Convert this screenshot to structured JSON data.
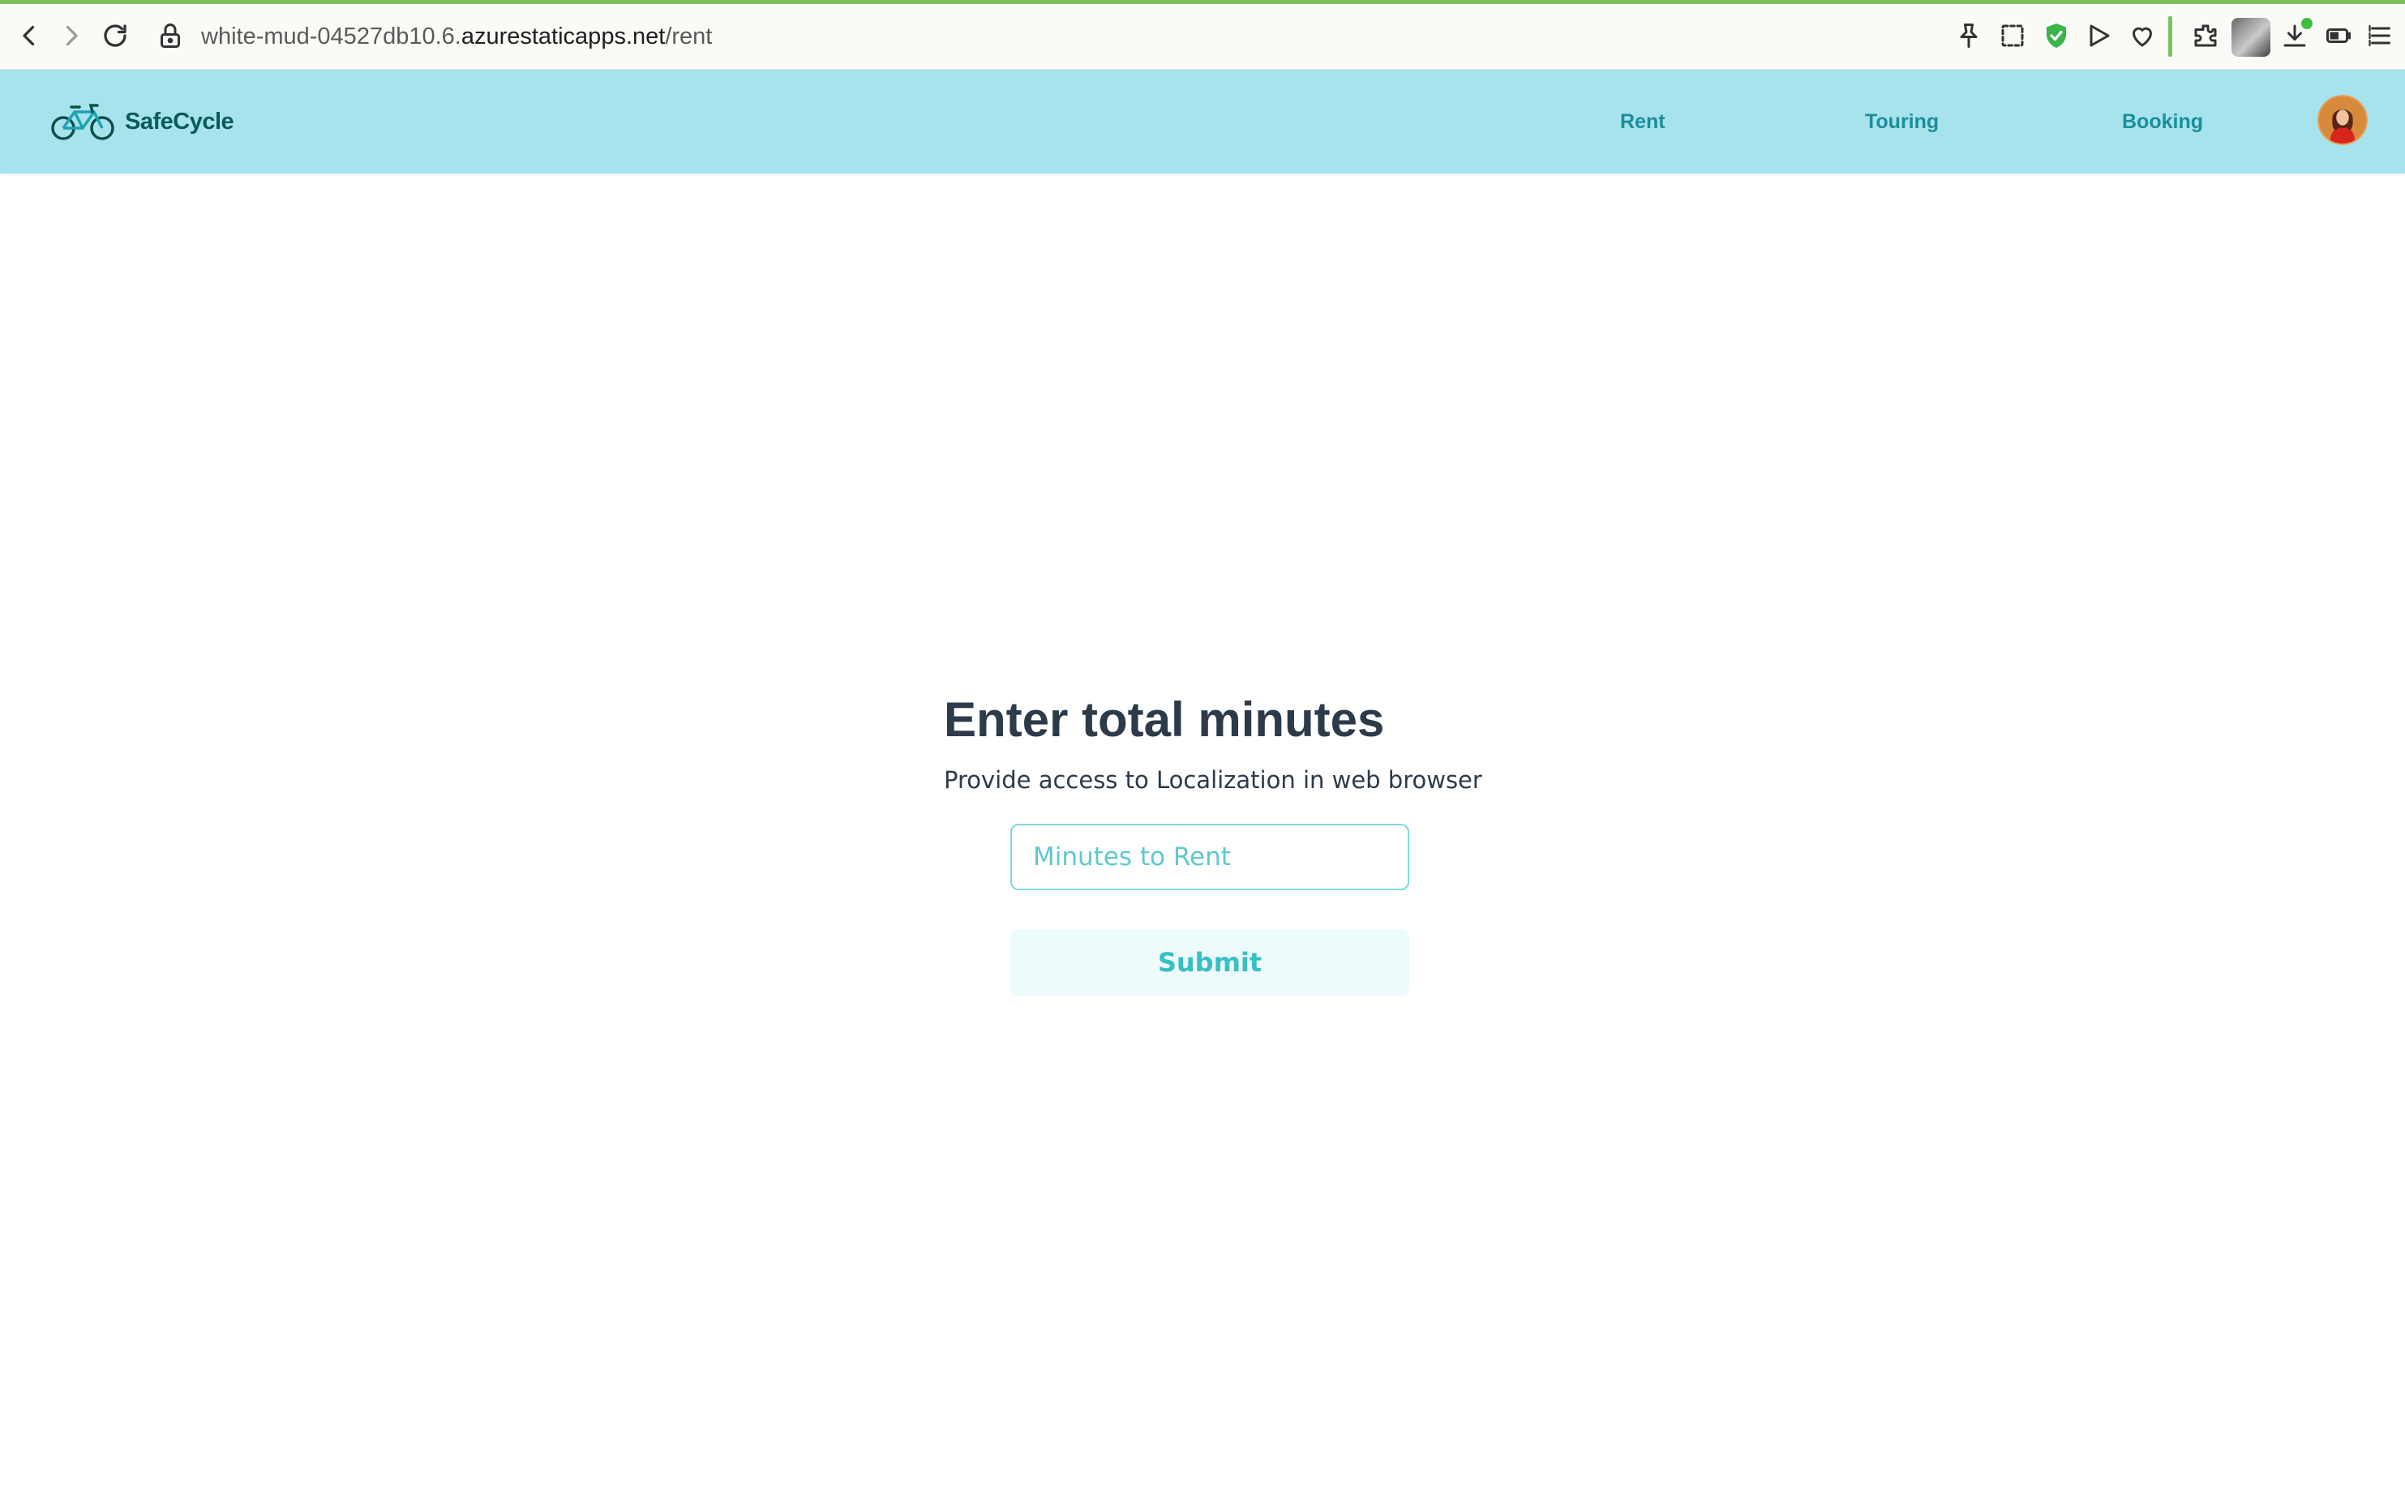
{
  "browser": {
    "url_prefix": "white-mud-04527db10.6.",
    "url_domain": "azurestaticapps.net",
    "url_path": "/rent",
    "icons": [
      "back-icon",
      "forward-icon",
      "reload-icon",
      "lock-icon",
      "pin-icon",
      "screenshot-icon",
      "shield-icon",
      "play-icon",
      "heart-icon",
      "extensions-icon",
      "download-icon",
      "battery-icon",
      "menu-icon"
    ]
  },
  "nav": {
    "brand": "SafeCycle",
    "links": [
      {
        "label": "Rent"
      },
      {
        "label": "Touring"
      },
      {
        "label": "Booking"
      }
    ]
  },
  "form": {
    "title": "Enter total minutes",
    "subtitle": "Provide access to Localization in web browser",
    "input_placeholder": "Minutes to Rent",
    "input_value": "",
    "submit_label": "Submit"
  },
  "colors": {
    "nav_bg": "#a7e3ec",
    "accent": "#37bfc6",
    "nav_link": "#1a8e9a",
    "heading": "#2d3a4a",
    "load_bar": "#7cc35e"
  }
}
